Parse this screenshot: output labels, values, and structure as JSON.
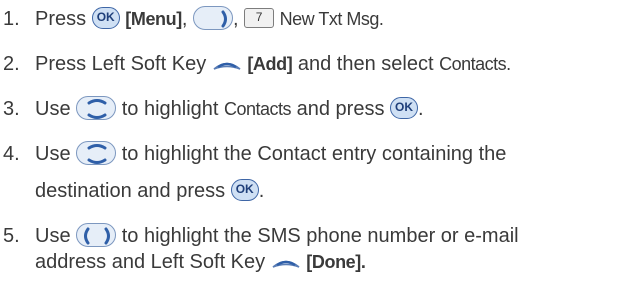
{
  "steps": [
    {
      "num": "1.",
      "press": "Press",
      "menu": "[Menu]",
      "comma1": ",",
      "comma2": ",",
      "newtxt": "New Txt Msg.",
      "ok_label": "OK",
      "key7_label": "7"
    },
    {
      "num": "2.",
      "text1": "Press Left Soft Key",
      "add": "[Add]",
      "text2": "and then select",
      "contacts": "Contacts."
    },
    {
      "num": "3.",
      "use": "Use",
      "text1": "to highlight",
      "contacts": "Contacts",
      "text2": "and press",
      "end": ".",
      "ok_label": "OK"
    },
    {
      "num": "4.",
      "use": "Use",
      "line1": "to highlight the Contact entry containing the",
      "line2": "destination and press",
      "end": ".",
      "ok_label": "OK"
    },
    {
      "num": "5.",
      "use": "Use",
      "line1": "to highlight the SMS phone number or e-mail",
      "line2": "address and Left Soft Key",
      "done": "[Done]."
    }
  ],
  "icons": [
    "ok-button-icon",
    "right-nav-key-icon",
    "key-7-icon",
    "left-soft-key-icon",
    "up-down-nav-key-icon",
    "left-right-nav-key-icon"
  ]
}
